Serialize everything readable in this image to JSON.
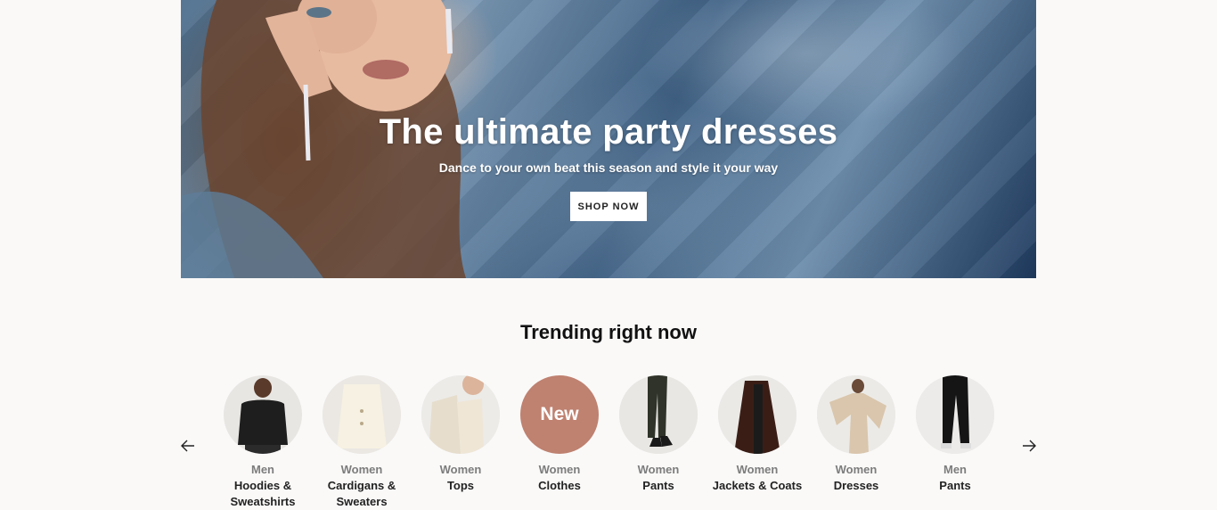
{
  "hero": {
    "title": "The ultimate party dresses",
    "subtitle": "Dance to your own beat this season and style it your way",
    "button_label": "SHOP NOW"
  },
  "trending": {
    "title": "Trending right now",
    "categories": [
      {
        "gender": "Men",
        "name": "Hoodies & Sweatshirts",
        "icon": "men-sweatshirt-image"
      },
      {
        "gender": "Women",
        "name": "Cardigans & Sweaters",
        "icon": "women-cardigan-image"
      },
      {
        "gender": "Women",
        "name": "Tops",
        "icon": "women-tops-image"
      },
      {
        "gender": "Women",
        "name": "Clothes",
        "badge": "New",
        "icon": "new-badge"
      },
      {
        "gender": "Women",
        "name": "Pants",
        "icon": "women-pants-image"
      },
      {
        "gender": "Women",
        "name": "Jackets & Coats",
        "icon": "women-coat-image"
      },
      {
        "gender": "Women",
        "name": "Dresses",
        "icon": "women-dress-image"
      },
      {
        "gender": "Men",
        "name": "Pants",
        "icon": "men-pants-image"
      }
    ]
  },
  "colors": {
    "page_background": "#faf9f8",
    "new_badge": "#bf8170",
    "hero_blue": "#4d6f8e"
  }
}
